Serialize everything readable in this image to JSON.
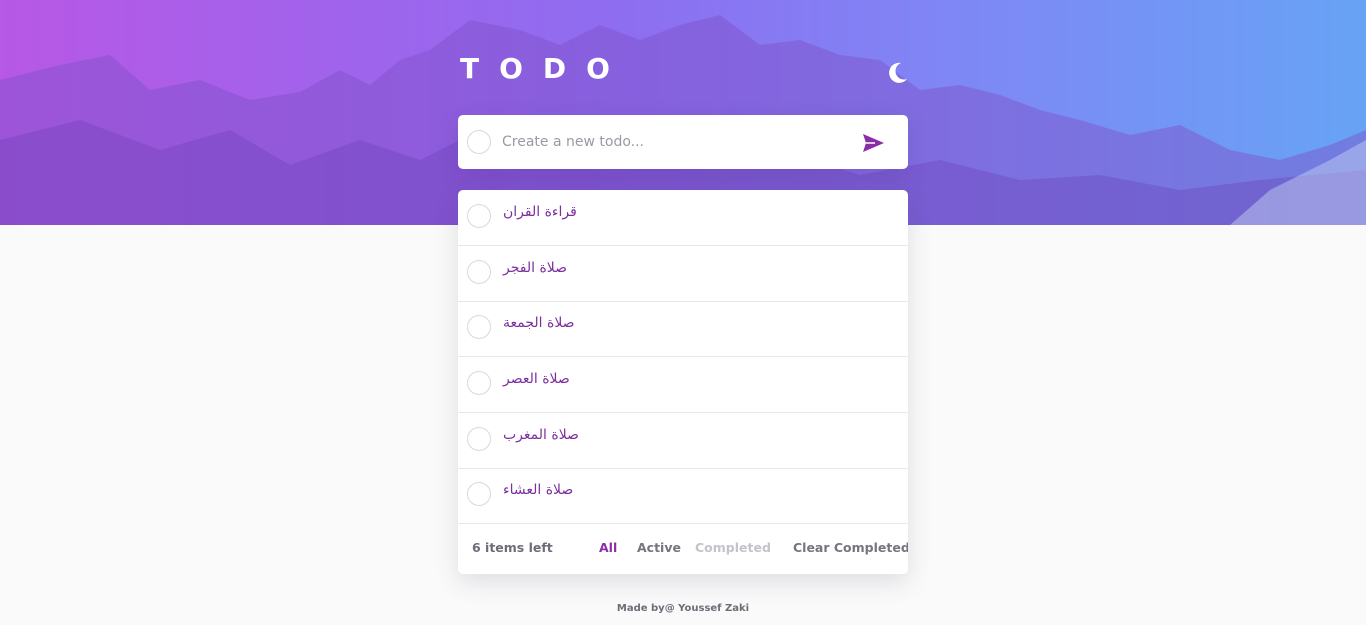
{
  "header": {
    "title": "TODO",
    "theme_toggle_icon": "moon-icon",
    "hero_image": "mountain-background"
  },
  "new_todo": {
    "placeholder": "Create a new todo...",
    "value": "",
    "send_icon": "send-icon"
  },
  "todos": [
    {
      "text": "قراءة القران",
      "completed": false
    },
    {
      "text": "صلاة الفجر",
      "completed": false
    },
    {
      "text": "صلاة الجمعة",
      "completed": false
    },
    {
      "text": "صلاة العصر",
      "completed": false
    },
    {
      "text": "صلاة المغرب",
      "completed": false
    },
    {
      "text": "صلاة العشاء",
      "completed": false
    }
  ],
  "footer": {
    "items_left": "6 items left",
    "filters": {
      "all": "All",
      "active": "Active",
      "completed": "Completed"
    },
    "selected_filter": "All",
    "clear_completed": "Clear Completed"
  },
  "credit": "Made by@ Youssef Zaki",
  "colors": {
    "accent": "#8a2ea8",
    "todo_text": "#7b2f9e",
    "gradient_start": "#b758e6",
    "gradient_end": "#67a3f5",
    "page_background": "#fafafa"
  }
}
